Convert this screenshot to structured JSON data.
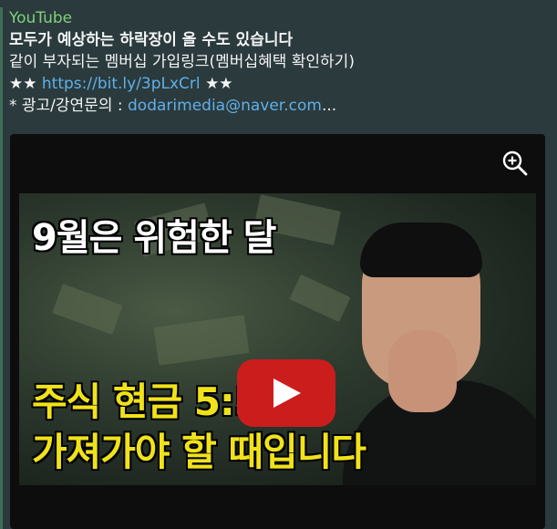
{
  "message": {
    "source": "YouTube",
    "title": "모두가 예상하는 하락장이 올 수도 있습니다",
    "membership_line": "같이 부자되는 멤버십 가입링크(멤버십혜택 확인하기)",
    "stars_left": "★★",
    "membership_link": "https://bit.ly/3pLxCrl",
    "stars_right": "★★",
    "inquiry_prefix": "* 광고/강연문의 : ",
    "inquiry_email": "dodarimedia@naver.com",
    "inquiry_ellipsis": "..."
  },
  "video": {
    "caption_top": "9월은 위험한 달",
    "caption_mid": "주식 현금 5:5로",
    "caption_bottom": "가져가야 할 때입니다"
  },
  "icons": {
    "zoom": "zoom-in-icon",
    "play": "play-icon"
  },
  "colors": {
    "background": "#2b3a3c",
    "source": "#7fd07f",
    "link": "#5fb0ea",
    "play_button": "#cc1d1d",
    "caption_yellow": "#f0e21a"
  }
}
